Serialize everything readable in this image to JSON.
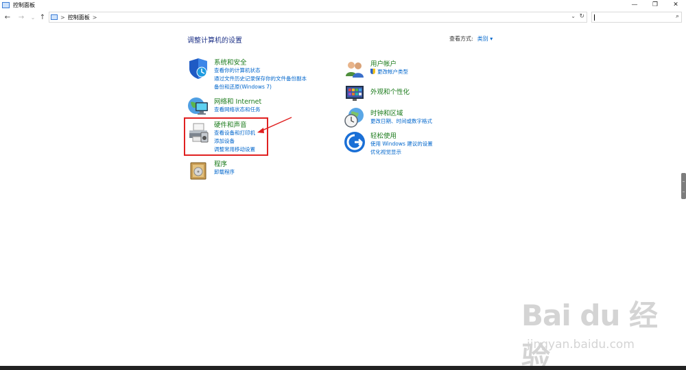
{
  "window": {
    "title": "控制面板"
  },
  "titlebar": {
    "minimize": "—",
    "maximize": "❐",
    "close": "✕"
  },
  "nav": {
    "back": "←",
    "forward": "→",
    "recent": "⌄",
    "up": "↑",
    "separator": ">",
    "crumb": "控制面板",
    "crumb_sep": ">",
    "dropdown": "⌄",
    "refresh": "↻",
    "search_icon": "⌕"
  },
  "main": {
    "heading": "调整计算机的设置",
    "view_by_label": "查看方式:",
    "view_by_value": "类别 ▾"
  },
  "categories_left": [
    {
      "title": "系统和安全",
      "icon": "shield-icon",
      "links": [
        "查看你的计算机状态",
        "通过文件历史记录保存你的文件备份副本",
        "备份和还原(Windows 7)"
      ]
    },
    {
      "title": "网络和 Internet",
      "icon": "network-icon",
      "links": [
        "查看网络状态和任务"
      ]
    },
    {
      "title": "硬件和声音",
      "icon": "printer-icon",
      "links": [
        "查看设备和打印机",
        "添加设备",
        "调整常用移动设置"
      ]
    },
    {
      "title": "程序",
      "icon": "programs-icon",
      "links": [
        "卸载程序"
      ]
    }
  ],
  "categories_right": [
    {
      "title": "用户帐户",
      "icon": "users-icon",
      "links": [
        "更改帐户类型"
      ]
    },
    {
      "title": "外观和个性化",
      "icon": "appearance-icon",
      "links": []
    },
    {
      "title": "时钟和区域",
      "icon": "clock-globe-icon",
      "links": [
        "更改日期、时间或数字格式"
      ]
    },
    {
      "title": "轻松使用",
      "icon": "ease-of-access-icon",
      "links": [
        "使用 Windows 建议的设置",
        "优化视觉显示"
      ]
    }
  ],
  "watermark": {
    "text": "Bai du 经验",
    "sub": "jingyan.baidu.com"
  },
  "colors": {
    "link": "#0066cc",
    "category": "#1a7a1a",
    "heading": "#1e3287",
    "annotation": "#e02020"
  }
}
